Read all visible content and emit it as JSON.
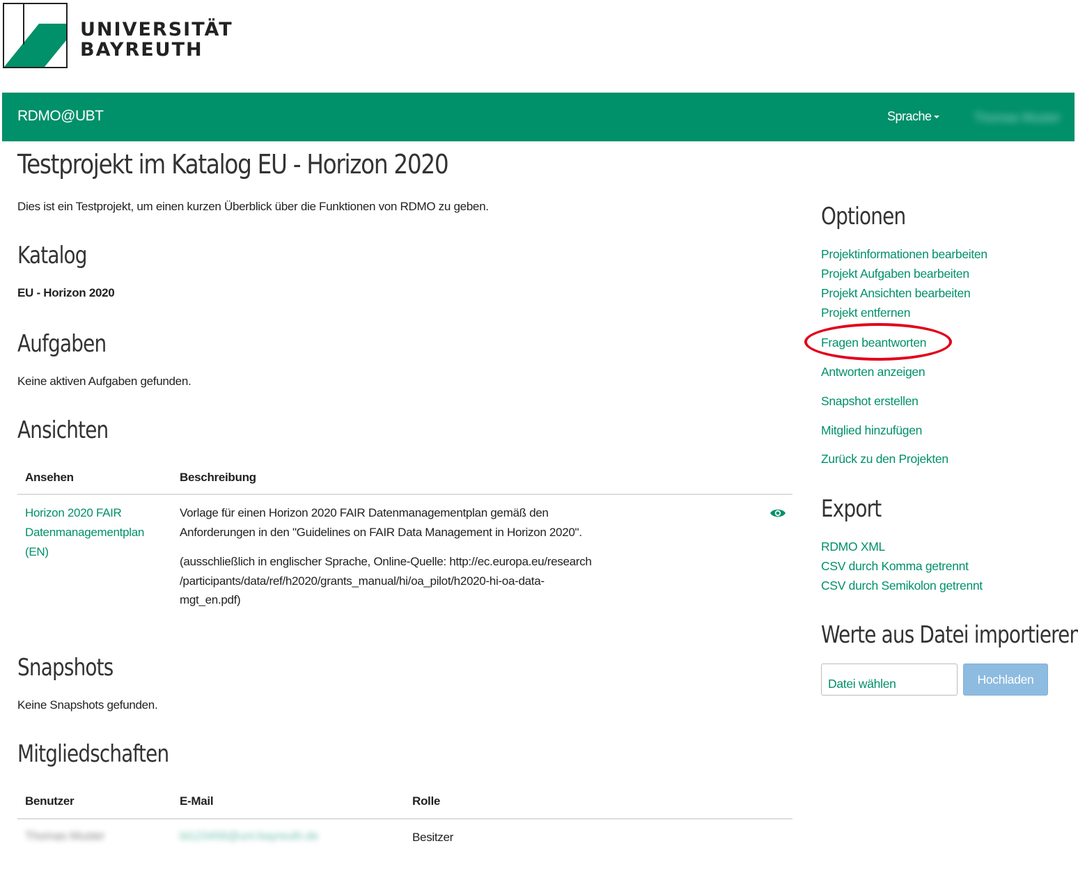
{
  "logo": {
    "line1": "UNIVERSITÄT",
    "line2": "BAYREUTH"
  },
  "navbar": {
    "brand": "RDMO@UBT",
    "language": "Sprache",
    "user": "Thomas Muster"
  },
  "page": {
    "title": "Testprojekt im Katalog EU - Horizon 2020",
    "description": "Dies ist ein Testprojekt, um einen kurzen Überblick über die Funktionen von RDMO zu geben."
  },
  "catalog": {
    "heading": "Katalog",
    "value": "EU - Horizon 2020"
  },
  "tasks": {
    "heading": "Aufgaben",
    "empty": "Keine aktiven Aufgaben gefunden."
  },
  "views": {
    "heading": "Ansichten",
    "columns": [
      "Ansehen",
      "Beschreibung"
    ],
    "rows": [
      {
        "name_lines": [
          "Horizon 2020 FAIR",
          "Datenmanagementplan",
          "(EN)"
        ],
        "desc_lines": [
          "Vorlage für einen Horizon 2020 FAIR Datenmanagementplan gemäß den",
          "Anforderungen in den \"Guidelines on FAIR Data Management in Horizon 2020\"."
        ],
        "note_lines": [
          "(ausschließlich in englischer Sprache, Online-Quelle: http://ec.europa.eu/research",
          "/participants/data/ref/h2020/grants_manual/hi/oa_pilot/h2020-hi-oa-data-",
          "mgt_en.pdf)"
        ],
        "icon": "eye-icon"
      }
    ]
  },
  "snapshots": {
    "heading": "Snapshots",
    "empty": "Keine Snapshots gefunden."
  },
  "memberships": {
    "heading": "Mitgliedschaften",
    "columns": [
      "Benutzer",
      "E-Mail",
      "Rolle"
    ],
    "rows": [
      {
        "user": "Thomas Muster",
        "email": "bt123456@uni-bayreuth.de",
        "role": "Besitzer"
      }
    ]
  },
  "options": {
    "heading": "Optionen",
    "links": [
      "Projektinformationen bearbeiten",
      "Projekt Aufgaben bearbeiten",
      "Projekt Ansichten bearbeiten",
      "Projekt entfernen",
      "Fragen beantworten",
      "Antworten anzeigen",
      "Snapshot erstellen",
      "Mitglied hinzufügen",
      "Zurück zu den Projekten"
    ]
  },
  "export": {
    "heading": "Export",
    "links": [
      "RDMO XML",
      "CSV durch Komma getrennt",
      "CSV durch Semikolon getrennt"
    ]
  },
  "import": {
    "heading": "Werte aus Datei importieren",
    "file_label": "Datei wählen",
    "upload_label": "Hochladen"
  },
  "colors": {
    "brand_green": "#00906a",
    "highlight_red": "#e2001a",
    "upload_blue": "#8ebbe0"
  }
}
